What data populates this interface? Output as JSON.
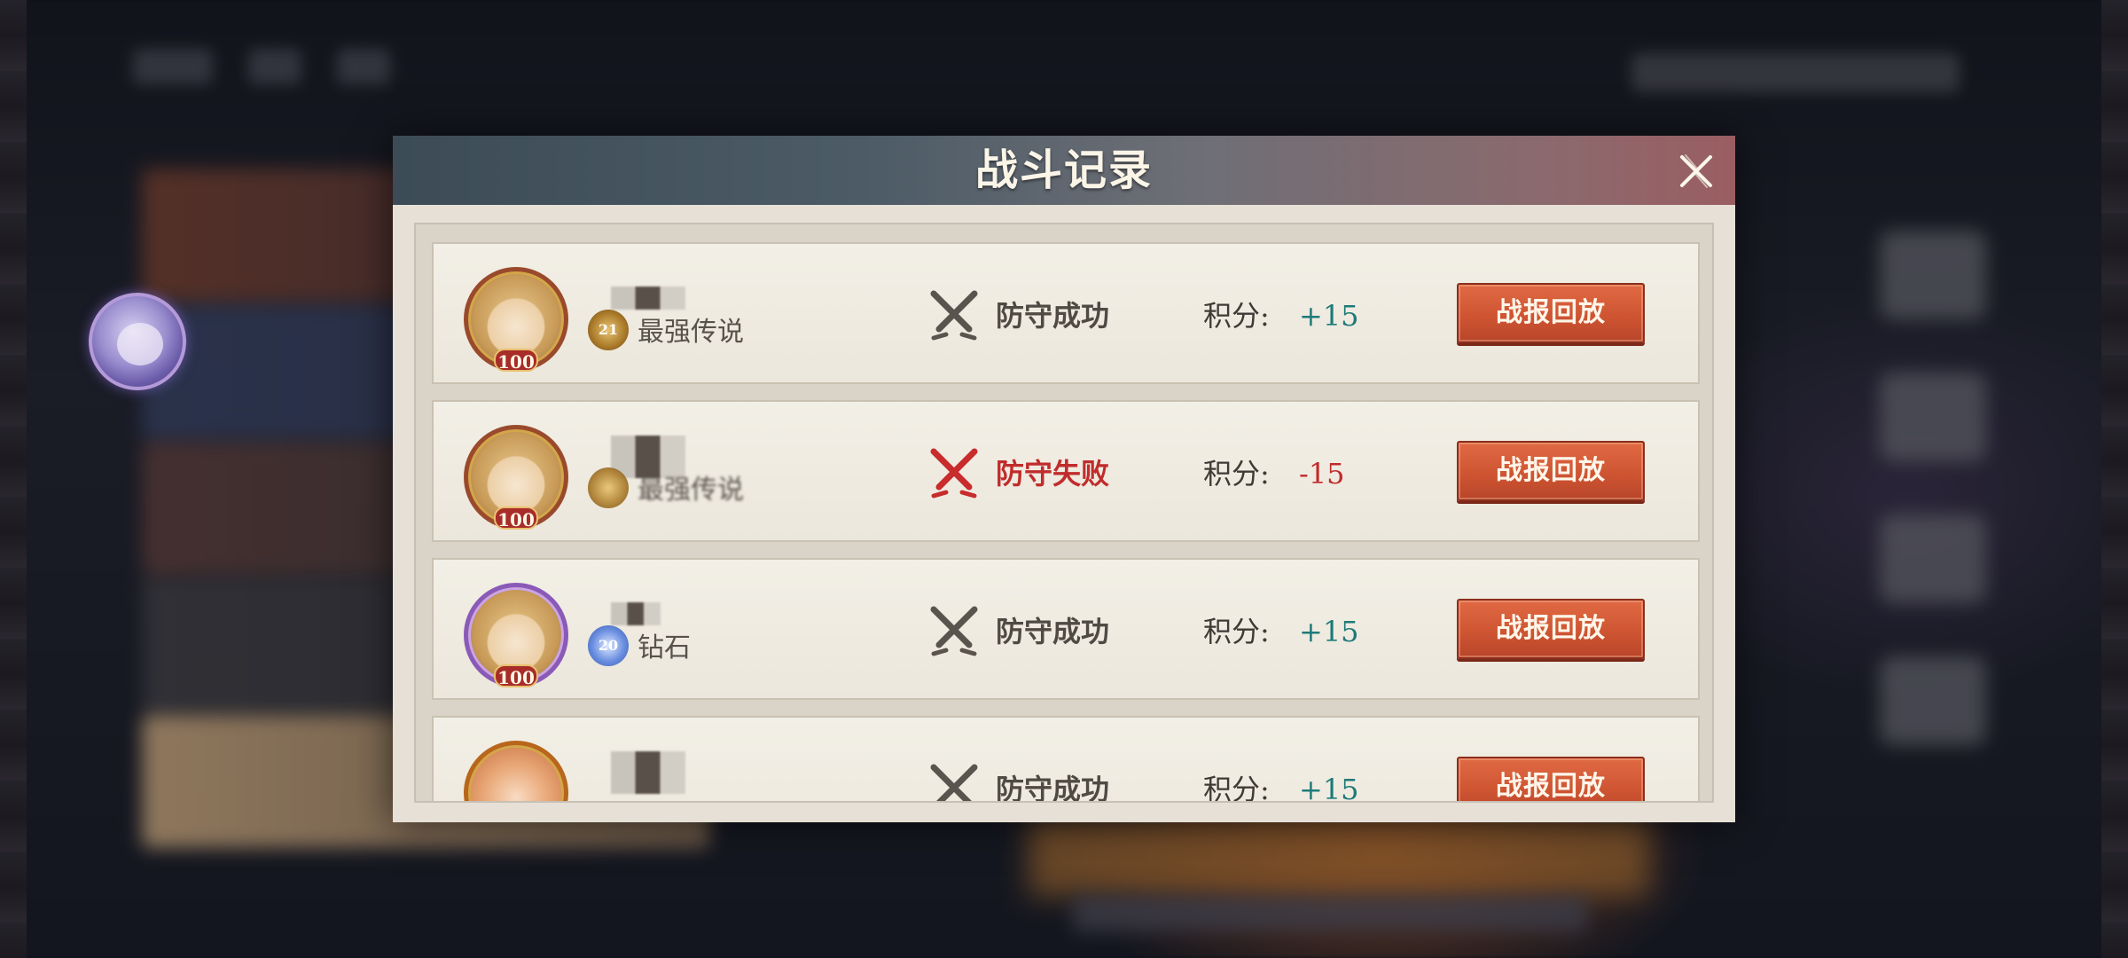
{
  "dialog": {
    "title": "战斗记录",
    "close_icon": "close-icon",
    "score_label": "积分:",
    "replay_label": "战报回放"
  },
  "records": [
    {
      "level": "100",
      "rank_level": "21",
      "rank_name": "最强传说",
      "result": "防守成功",
      "outcome": "success",
      "score": "+15"
    },
    {
      "level": "100",
      "rank_level": "",
      "rank_name": "最强传说",
      "result": "防守失败",
      "outcome": "fail",
      "score": "-15"
    },
    {
      "level": "100",
      "rank_level": "20",
      "rank_name": "钻石",
      "result": "防守成功",
      "outcome": "success",
      "score": "+15"
    },
    {
      "level": "",
      "rank_level": "",
      "rank_name": "",
      "result": "防守成功",
      "outcome": "success",
      "score": "+15"
    }
  ],
  "colors": {
    "success_icon": "#5a544e",
    "fail_icon": "#c82c2c",
    "positive_score": "#1e7a78",
    "negative_score": "#c02c2c",
    "button": "#cf5532"
  }
}
